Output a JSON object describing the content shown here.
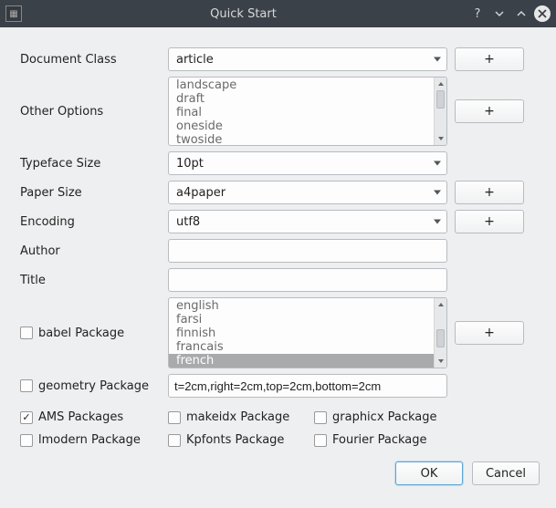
{
  "titlebar": {
    "title": "Quick Start"
  },
  "labels": {
    "documentClass": "Document Class",
    "otherOptions": "Other Options",
    "typefaceSize": "Typeface Size",
    "paperSize": "Paper Size",
    "encoding": "Encoding",
    "author": "Author",
    "title": "Title",
    "babel": "babel Package",
    "geometry": "geometry Package",
    "ams": "AMS Packages",
    "lmodern": "lmodern Package",
    "makeidx": "makeidx Package",
    "kpfonts": "Kpfonts Package",
    "graphicx": "graphicx Package",
    "fourier": "Fourier Package"
  },
  "values": {
    "documentClass": "article",
    "typefaceSize": "10pt",
    "paperSize": "a4paper",
    "encoding": "utf8",
    "author": "",
    "title": "",
    "geometry": "t=2cm,right=2cm,top=2cm,bottom=2cm"
  },
  "otherOptions": [
    "landscape",
    "draft",
    "final",
    "oneside",
    "twoside"
  ],
  "babelLanguages": [
    "english",
    "farsi",
    "finnish",
    "francais",
    "french"
  ],
  "babelSelected": "french",
  "checks": {
    "babel": false,
    "geometry": false,
    "ams": true,
    "lmodern": false,
    "makeidx": false,
    "kpfonts": false,
    "graphicx": false,
    "fourier": false
  },
  "buttons": {
    "plus": "+",
    "ok": "OK",
    "cancel": "Cancel"
  }
}
